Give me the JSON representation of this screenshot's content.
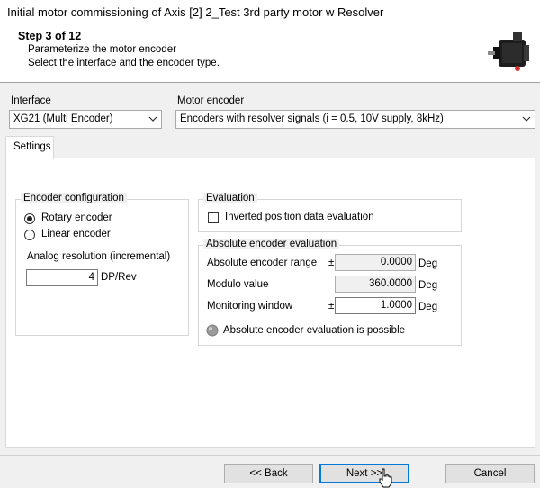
{
  "window": {
    "title": "Initial motor commissioning of Axis [2] 2_Test 3rd party motor w Resolver"
  },
  "header": {
    "step": "Step 3 of 12",
    "subtitle": "Parameterize the motor encoder",
    "description": "Select the interface and the encoder type.",
    "icon": "servo-motor-icon"
  },
  "interface": {
    "label": "Interface",
    "value": "XG21 (Multi Encoder)"
  },
  "motor_encoder": {
    "label": "Motor encoder",
    "value": "Encoders with resolver signals (i = 0.5, 10V supply, 8kHz)"
  },
  "tabs": [
    {
      "label": "Settings"
    }
  ],
  "encoder_configuration": {
    "title": "Encoder configuration",
    "rotary_label": "Rotary encoder",
    "linear_label": "Linear encoder",
    "selected": "rotary",
    "analog_label": "Analog resolution (incremental)",
    "analog_value": "4",
    "analog_unit": "DP/Rev"
  },
  "evaluation": {
    "title": "Evaluation",
    "inverted_label": "Inverted position data evaluation",
    "inverted_checked": false
  },
  "absolute": {
    "title": "Absolute encoder evaluation",
    "range_label": "Absolute encoder range",
    "range_sign": "±",
    "range_value": "0.0000",
    "range_unit": "Deg",
    "modulo_label": "Modulo value",
    "modulo_value": "360.0000",
    "modulo_unit": "Deg",
    "monitor_label": "Monitoring window",
    "monitor_sign": "±",
    "monitor_value": "1.0000",
    "monitor_unit": "Deg",
    "possible_label": "Absolute encoder evaluation is possible",
    "indicator_color": "#9a9a9a"
  },
  "buttons": {
    "back": "<< Back",
    "next": "Next >>",
    "cancel": "Cancel"
  }
}
